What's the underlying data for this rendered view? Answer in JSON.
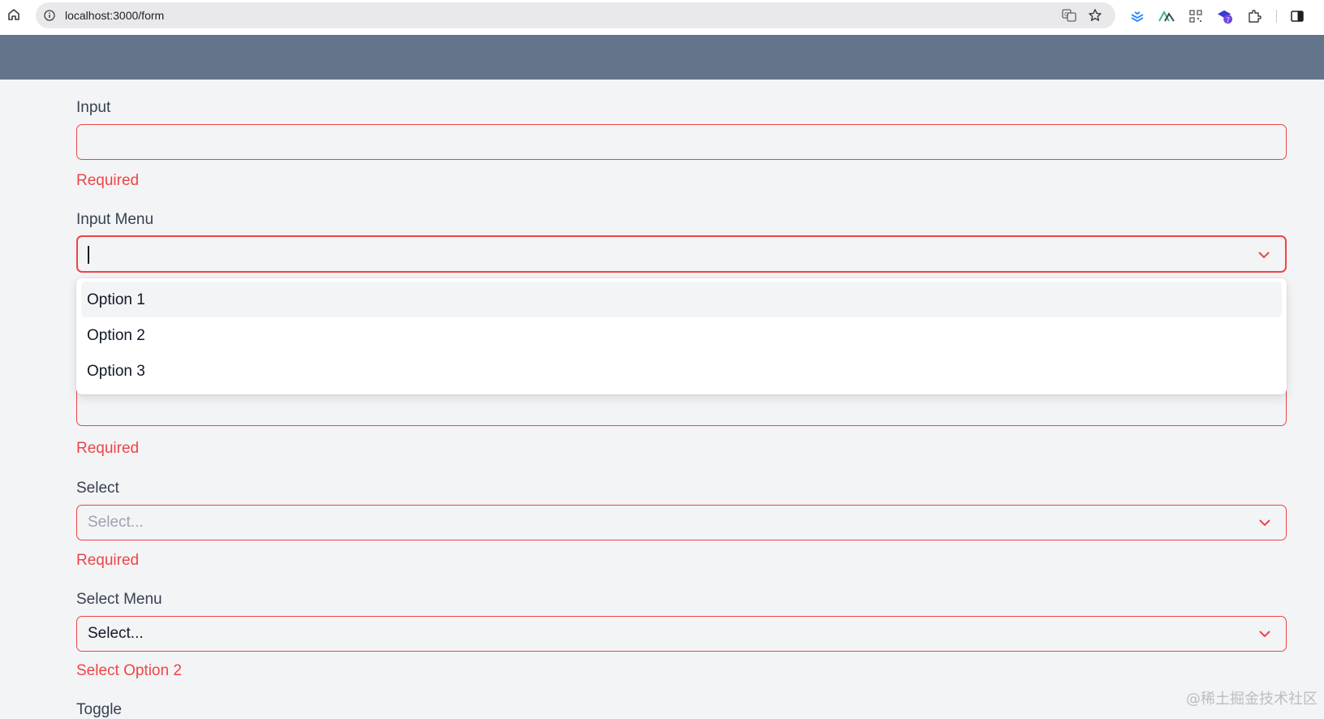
{
  "browser": {
    "url": "localhost:3000/form",
    "extension_badge": "7"
  },
  "form": {
    "input": {
      "label": "Input",
      "value": "",
      "error": "Required"
    },
    "input_menu": {
      "label": "Input Menu",
      "value": "",
      "options": [
        "Option 1",
        "Option 2",
        "Option 3"
      ],
      "highlighted_option": 0,
      "error": "Required"
    },
    "select": {
      "label": "Select",
      "placeholder": "Select...",
      "error": "Required"
    },
    "select_menu": {
      "label": "Select Menu",
      "value": "Select...",
      "error": "Select Option 2"
    },
    "toggle": {
      "label": "Toggle"
    }
  },
  "colors": {
    "header": "#64748b",
    "error": "#ef4444",
    "background": "#f3f4f6"
  },
  "watermark": "@稀土掘金技术社区"
}
